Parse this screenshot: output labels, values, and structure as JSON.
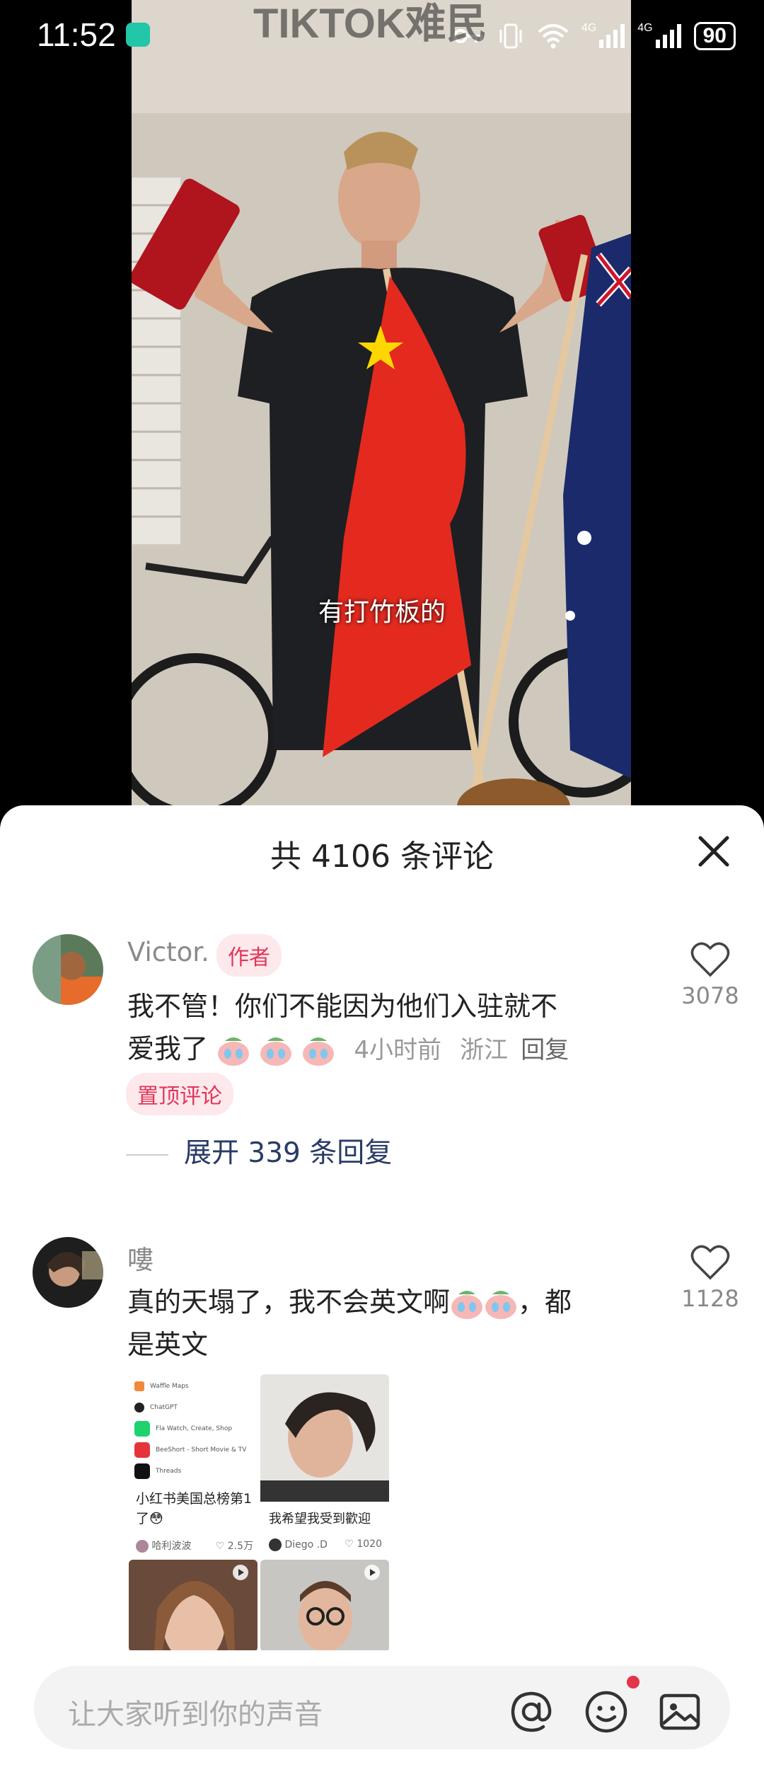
{
  "status_bar": {
    "time": "11:52",
    "signal_1": "4G",
    "signal_2": "4G",
    "battery": "90"
  },
  "video": {
    "watermark": "TIKTOK难民",
    "caption": "有打竹板的"
  },
  "comments_panel": {
    "title": "共 4106 条评论",
    "comments": [
      {
        "author": "Victor.",
        "author_tag": "作者",
        "text_line1": "我不管！你们不能因为他们入驻就不",
        "text_line2": "爱我了",
        "time": "4小时前",
        "location": "浙江",
        "reply_label": "回复",
        "pinned_label": "置顶评论",
        "likes": "3078",
        "expand_replies": "展开 339 条回复"
      },
      {
        "author": "嘍",
        "text_line1a": "真的天塌了，我不会英文啊",
        "text_line1b": "，都",
        "text_line2": "是英文",
        "likes": "1128"
      }
    ],
    "attached_posts": [
      {
        "title": "小红书美国总榜第1了😳",
        "author": "哈利波波",
        "likes": "2.5万",
        "app_list": [
          "Waffle Maps",
          "ChatGPT",
          "Fla Watch, Create, Shop",
          "BeeShort - Short Movie & TV",
          "Threads"
        ]
      },
      {
        "title": "我希望我受到歡迎",
        "author": "Diego .D",
        "likes": "1020"
      }
    ]
  },
  "input_bar": {
    "placeholder": "让大家听到你的声音"
  },
  "colors": {
    "accent_red": "#e0375a",
    "tag_bg": "#fde8ec",
    "link_blue": "#2a3b66"
  }
}
